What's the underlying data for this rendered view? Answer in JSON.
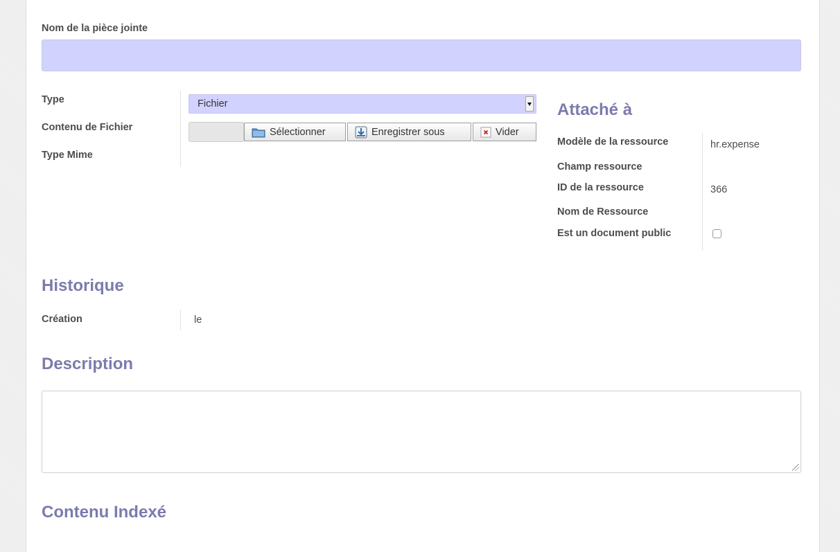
{
  "attachment_name": {
    "label": "Nom de la pièce jointe",
    "value": ""
  },
  "file_fields": {
    "type_label": "Type",
    "type_value": "Fichier",
    "content_label": "Contenu de Fichier",
    "mime_label": "Type Mime",
    "select_button": "Sélectionner",
    "save_as_button": "Enregistrer sous",
    "clear_button": "Vider"
  },
  "attached": {
    "title": "Attaché à",
    "model_label": "Modèle de la ressource",
    "model_value": "hr.expense",
    "field_label": "Champ ressource",
    "id_label": "ID de la ressource",
    "id_value": "366",
    "name_label": "Nom de Ressource",
    "public_label": "Est un document public",
    "public_checked": false
  },
  "history": {
    "title": "Historique",
    "creation_label": "Création",
    "creation_value": "le"
  },
  "description": {
    "title": "Description",
    "value": ""
  },
  "indexed": {
    "title": "Contenu Indexé"
  },
  "colors": {
    "accent": "#7c7bad",
    "required_field": "#d2d2ff"
  }
}
